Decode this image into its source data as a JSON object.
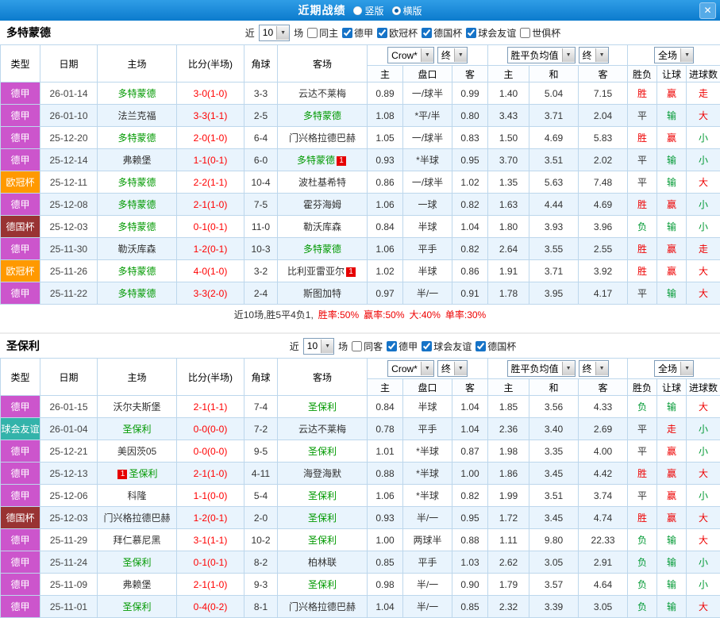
{
  "icons": {
    "close": "✕",
    "chevron_down": "▼"
  },
  "titlebar": {
    "title": "近期战绩",
    "layout_options": [
      {
        "label": "竖版",
        "selected": false
      },
      {
        "label": "横版",
        "selected": true
      }
    ]
  },
  "table_header": {
    "fixed": [
      "类型",
      "日期",
      "主场",
      "比分(半场)",
      "角球",
      "客场"
    ],
    "bookmaker": "Crow*",
    "period1": "终",
    "avg_label": "胜平负均值",
    "period2": "终",
    "scope": "全场",
    "sub": [
      "主",
      "盘口",
      "客",
      "主",
      "和",
      "客",
      "胜负",
      "让球",
      "进球数"
    ]
  },
  "league_colors": {
    "德甲": "#cc55cc",
    "欧冠杯": "#ff9900",
    "德国杯": "#993333",
    "球会友谊": "#33b3aa"
  },
  "result_colors": {
    "r": "#ee0000",
    "g": "#009933",
    "d": "#333333"
  },
  "sections": [
    {
      "team": "多特蒙德",
      "filter": {
        "prefix": "近",
        "count": "10",
        "suffix": "场",
        "checkboxes": [
          {
            "label": "同主",
            "checked": false
          },
          {
            "label": "德甲",
            "checked": true
          },
          {
            "label": "欧冠杯",
            "checked": true
          },
          {
            "label": "德国杯",
            "checked": true
          },
          {
            "label": "球会友谊",
            "checked": true
          },
          {
            "label": "世俱杯",
            "checked": false
          }
        ]
      },
      "rows": [
        {
          "league": "德甲",
          "date": "26-01-14",
          "home": {
            "name": "多特蒙德",
            "self": true
          },
          "score": "3-0(1-0)",
          "corner": "3-3",
          "away": {
            "name": "云达不莱梅",
            "self": false
          },
          "odds": [
            "0.89",
            "一/球半",
            "0.99"
          ],
          "avg": [
            "1.40",
            "5.04",
            "7.15"
          ],
          "results": [
            {
              "text": "胜",
              "c": "r"
            },
            {
              "text": "赢",
              "c": "r"
            },
            {
              "text": "走",
              "c": "r"
            }
          ]
        },
        {
          "league": "德甲",
          "date": "26-01-10",
          "home": {
            "name": "法兰克福",
            "self": false
          },
          "score": "3-3(1-1)",
          "corner": "2-5",
          "away": {
            "name": "多特蒙德",
            "self": true
          },
          "odds": [
            "1.08",
            "*平/半",
            "0.80"
          ],
          "avg": [
            "3.43",
            "3.71",
            "2.04"
          ],
          "results": [
            {
              "text": "平",
              "c": "d"
            },
            {
              "text": "输",
              "c": "g"
            },
            {
              "text": "大",
              "c": "r"
            }
          ]
        },
        {
          "league": "德甲",
          "date": "25-12-20",
          "home": {
            "name": "多特蒙德",
            "self": true
          },
          "score": "2-0(1-0)",
          "corner": "6-4",
          "away": {
            "name": "门兴格拉德巴赫",
            "self": false
          },
          "odds": [
            "1.05",
            "一/球半",
            "0.83"
          ],
          "avg": [
            "1.50",
            "4.69",
            "5.83"
          ],
          "results": [
            {
              "text": "胜",
              "c": "r"
            },
            {
              "text": "赢",
              "c": "r"
            },
            {
              "text": "小",
              "c": "g"
            }
          ]
        },
        {
          "league": "德甲",
          "date": "25-12-14",
          "home": {
            "name": "弗赖堡",
            "self": false
          },
          "score": "1-1(0-1)",
          "corner": "6-0",
          "away": {
            "name": "多特蒙德",
            "self": true,
            "badge": "1",
            "badge_side": "after"
          },
          "odds": [
            "0.93",
            "*半球",
            "0.95"
          ],
          "avg": [
            "3.70",
            "3.51",
            "2.02"
          ],
          "results": [
            {
              "text": "平",
              "c": "d"
            },
            {
              "text": "输",
              "c": "g"
            },
            {
              "text": "小",
              "c": "g"
            }
          ]
        },
        {
          "league": "欧冠杯",
          "date": "25-12-11",
          "home": {
            "name": "多特蒙德",
            "self": true
          },
          "score": "2-2(1-1)",
          "corner": "10-4",
          "away": {
            "name": "波杜基希特",
            "self": false
          },
          "odds": [
            "0.86",
            "一/球半",
            "1.02"
          ],
          "avg": [
            "1.35",
            "5.63",
            "7.48"
          ],
          "results": [
            {
              "text": "平",
              "c": "d"
            },
            {
              "text": "输",
              "c": "g"
            },
            {
              "text": "大",
              "c": "r"
            }
          ]
        },
        {
          "league": "德甲",
          "date": "25-12-08",
          "home": {
            "name": "多特蒙德",
            "self": true
          },
          "score": "2-1(1-0)",
          "corner": "7-5",
          "away": {
            "name": "霍芬海姆",
            "self": false
          },
          "odds": [
            "1.06",
            "一球",
            "0.82"
          ],
          "avg": [
            "1.63",
            "4.44",
            "4.69"
          ],
          "results": [
            {
              "text": "胜",
              "c": "r"
            },
            {
              "text": "赢",
              "c": "r"
            },
            {
              "text": "小",
              "c": "g"
            }
          ]
        },
        {
          "league": "德国杯",
          "date": "25-12-03",
          "home": {
            "name": "多特蒙德",
            "self": true
          },
          "score": "0-1(0-1)",
          "corner": "11-0",
          "away": {
            "name": "勒沃库森",
            "self": false
          },
          "odds": [
            "0.84",
            "半球",
            "1.04"
          ],
          "avg": [
            "1.80",
            "3.93",
            "3.96"
          ],
          "results": [
            {
              "text": "负",
              "c": "g"
            },
            {
              "text": "输",
              "c": "g"
            },
            {
              "text": "小",
              "c": "g"
            }
          ]
        },
        {
          "league": "德甲",
          "date": "25-11-30",
          "home": {
            "name": "勒沃库森",
            "self": false
          },
          "score": "1-2(0-1)",
          "corner": "10-3",
          "away": {
            "name": "多特蒙德",
            "self": true
          },
          "odds": [
            "1.06",
            "平手",
            "0.82"
          ],
          "avg": [
            "2.64",
            "3.55",
            "2.55"
          ],
          "results": [
            {
              "text": "胜",
              "c": "r"
            },
            {
              "text": "赢",
              "c": "r"
            },
            {
              "text": "走",
              "c": "r"
            }
          ]
        },
        {
          "league": "欧冠杯",
          "date": "25-11-26",
          "home": {
            "name": "多特蒙德",
            "self": true
          },
          "score": "4-0(1-0)",
          "corner": "3-2",
          "away": {
            "name": "比利亚雷亚尔",
            "self": false,
            "badge": "1",
            "badge_side": "after"
          },
          "odds": [
            "1.02",
            "半球",
            "0.86"
          ],
          "avg": [
            "1.91",
            "3.71",
            "3.92"
          ],
          "results": [
            {
              "text": "胜",
              "c": "r"
            },
            {
              "text": "赢",
              "c": "r"
            },
            {
              "text": "大",
              "c": "r"
            }
          ]
        },
        {
          "league": "德甲",
          "date": "25-11-22",
          "home": {
            "name": "多特蒙德",
            "self": true
          },
          "score": "3-3(2-0)",
          "corner": "2-4",
          "away": {
            "name": "斯图加特",
            "self": false
          },
          "odds": [
            "0.97",
            "半/一",
            "0.91"
          ],
          "avg": [
            "1.78",
            "3.95",
            "4.17"
          ],
          "results": [
            {
              "text": "平",
              "c": "d"
            },
            {
              "text": "输",
              "c": "g"
            },
            {
              "text": "大",
              "c": "r"
            }
          ]
        }
      ],
      "summary": [
        {
          "text": "近10场,胜5平4负1,",
          "c": "d"
        },
        {
          "text": "胜率:50%",
          "c": "r"
        },
        {
          "text": "赢率:50%",
          "c": "r"
        },
        {
          "text": "大:40%",
          "c": "r"
        },
        {
          "text": "单率:30%",
          "c": "r"
        }
      ]
    },
    {
      "team": "圣保利",
      "filter": {
        "prefix": "近",
        "count": "10",
        "suffix": "场",
        "checkboxes": [
          {
            "label": "同客",
            "checked": false
          },
          {
            "label": "德甲",
            "checked": true
          },
          {
            "label": "球会友谊",
            "checked": true
          },
          {
            "label": "德国杯",
            "checked": true
          }
        ]
      },
      "rows": [
        {
          "league": "德甲",
          "date": "26-01-15",
          "home": {
            "name": "沃尔夫斯堡",
            "self": false
          },
          "score": "2-1(1-1)",
          "corner": "7-4",
          "away": {
            "name": "圣保利",
            "self": true
          },
          "odds": [
            "0.84",
            "半球",
            "1.04"
          ],
          "avg": [
            "1.85",
            "3.56",
            "4.33"
          ],
          "results": [
            {
              "text": "负",
              "c": "g"
            },
            {
              "text": "输",
              "c": "g"
            },
            {
              "text": "大",
              "c": "r"
            }
          ]
        },
        {
          "league": "球会友谊",
          "date": "26-01-04",
          "home": {
            "name": "圣保利",
            "self": true
          },
          "score": "0-0(0-0)",
          "corner": "7-2",
          "away": {
            "name": "云达不莱梅",
            "self": false
          },
          "odds": [
            "0.78",
            "平手",
            "1.04"
          ],
          "avg": [
            "2.36",
            "3.40",
            "2.69"
          ],
          "results": [
            {
              "text": "平",
              "c": "d"
            },
            {
              "text": "走",
              "c": "r"
            },
            {
              "text": "小",
              "c": "g"
            }
          ]
        },
        {
          "league": "德甲",
          "date": "25-12-21",
          "home": {
            "name": "美因茨05",
            "self": false
          },
          "score": "0-0(0-0)",
          "corner": "9-5",
          "away": {
            "name": "圣保利",
            "self": true
          },
          "odds": [
            "1.01",
            "*半球",
            "0.87"
          ],
          "avg": [
            "1.98",
            "3.35",
            "4.00"
          ],
          "results": [
            {
              "text": "平",
              "c": "d"
            },
            {
              "text": "赢",
              "c": "r"
            },
            {
              "text": "小",
              "c": "g"
            }
          ]
        },
        {
          "league": "德甲",
          "date": "25-12-13",
          "home": {
            "name": "圣保利",
            "self": true,
            "badge": "1",
            "badge_side": "before"
          },
          "score": "2-1(1-0)",
          "corner": "4-11",
          "away": {
            "name": "海登海默",
            "self": false
          },
          "odds": [
            "0.88",
            "*半球",
            "1.00"
          ],
          "avg": [
            "1.86",
            "3.45",
            "4.42"
          ],
          "results": [
            {
              "text": "胜",
              "c": "r"
            },
            {
              "text": "赢",
              "c": "r"
            },
            {
              "text": "大",
              "c": "r"
            }
          ]
        },
        {
          "league": "德甲",
          "date": "25-12-06",
          "home": {
            "name": "科隆",
            "self": false
          },
          "score": "1-1(0-0)",
          "corner": "5-4",
          "away": {
            "name": "圣保利",
            "self": true
          },
          "odds": [
            "1.06",
            "*半球",
            "0.82"
          ],
          "avg": [
            "1.99",
            "3.51",
            "3.74"
          ],
          "results": [
            {
              "text": "平",
              "c": "d"
            },
            {
              "text": "赢",
              "c": "r"
            },
            {
              "text": "小",
              "c": "g"
            }
          ]
        },
        {
          "league": "德国杯",
          "date": "25-12-03",
          "home": {
            "name": "门兴格拉德巴赫",
            "self": false
          },
          "score": "1-2(0-1)",
          "corner": "2-0",
          "away": {
            "name": "圣保利",
            "self": true
          },
          "odds": [
            "0.93",
            "半/一",
            "0.95"
          ],
          "avg": [
            "1.72",
            "3.45",
            "4.74"
          ],
          "results": [
            {
              "text": "胜",
              "c": "r"
            },
            {
              "text": "赢",
              "c": "r"
            },
            {
              "text": "大",
              "c": "r"
            }
          ]
        },
        {
          "league": "德甲",
          "date": "25-11-29",
          "home": {
            "name": "拜仁慕尼黑",
            "self": false
          },
          "score": "3-1(1-1)",
          "corner": "10-2",
          "away": {
            "name": "圣保利",
            "self": true
          },
          "odds": [
            "1.00",
            "两球半",
            "0.88"
          ],
          "avg": [
            "1.11",
            "9.80",
            "22.33"
          ],
          "results": [
            {
              "text": "负",
              "c": "g"
            },
            {
              "text": "输",
              "c": "g"
            },
            {
              "text": "大",
              "c": "r"
            }
          ]
        },
        {
          "league": "德甲",
          "date": "25-11-24",
          "home": {
            "name": "圣保利",
            "self": true
          },
          "score": "0-1(0-1)",
          "corner": "8-2",
          "away": {
            "name": "柏林联",
            "self": false
          },
          "odds": [
            "0.85",
            "平手",
            "1.03"
          ],
          "avg": [
            "2.62",
            "3.05",
            "2.91"
          ],
          "results": [
            {
              "text": "负",
              "c": "g"
            },
            {
              "text": "输",
              "c": "g"
            },
            {
              "text": "小",
              "c": "g"
            }
          ]
        },
        {
          "league": "德甲",
          "date": "25-11-09",
          "home": {
            "name": "弗赖堡",
            "self": false
          },
          "score": "2-1(1-0)",
          "corner": "9-3",
          "away": {
            "name": "圣保利",
            "self": true
          },
          "odds": [
            "0.98",
            "半/一",
            "0.90"
          ],
          "avg": [
            "1.79",
            "3.57",
            "4.64"
          ],
          "results": [
            {
              "text": "负",
              "c": "g"
            },
            {
              "text": "输",
              "c": "g"
            },
            {
              "text": "小",
              "c": "g"
            }
          ]
        },
        {
          "league": "德甲",
          "date": "25-11-01",
          "home": {
            "name": "圣保利",
            "self": true
          },
          "score": "0-4(0-2)",
          "corner": "8-1",
          "away": {
            "name": "门兴格拉德巴赫",
            "self": false
          },
          "odds": [
            "1.04",
            "半/一",
            "0.85"
          ],
          "avg": [
            "2.32",
            "3.39",
            "3.05"
          ],
          "results": [
            {
              "text": "负",
              "c": "g"
            },
            {
              "text": "输",
              "c": "g"
            },
            {
              "text": "大",
              "c": "r"
            }
          ]
        }
      ],
      "summary": []
    }
  ]
}
